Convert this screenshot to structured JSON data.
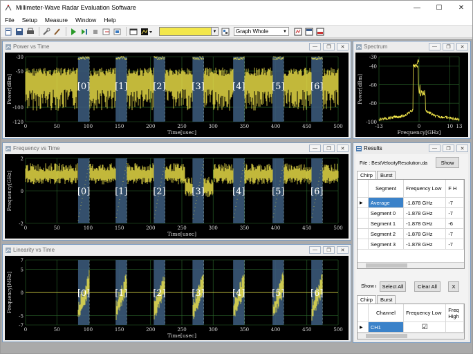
{
  "app": {
    "title": "Millimeter-Wave Radar Evaluation Software"
  },
  "menu": [
    "File",
    "Setup",
    "Measure",
    "Window",
    "Help"
  ],
  "toolbar": {
    "graph_mode": "Graph Whole",
    "trace_color": "#f3e74a"
  },
  "panels": {
    "power": {
      "title": "Power vs Time",
      "chart_data": {
        "type": "line",
        "xlabel": "Time[usec]",
        "ylabel": "Power[dBm]",
        "xlim": [
          0,
          500
        ],
        "ylim": [
          -120,
          -30
        ],
        "x_ticks": [
          "0",
          "50",
          "100",
          "150",
          "200",
          "250",
          "300",
          "350",
          "400",
          "450",
          "500"
        ],
        "y_ticks": [
          "-30",
          "-50",
          "-100",
          "-120"
        ],
        "chirp_labels": [
          "[0]",
          "[1]",
          "[2]",
          "[3]",
          "[4]",
          "[5]",
          "[6]"
        ],
        "chirp_centers": [
          92,
          152,
          213,
          275,
          340,
          403,
          465
        ]
      }
    },
    "spectrum": {
      "title": "Spectrum",
      "chart_data": {
        "type": "line",
        "xlabel": "Frequency[GHz]",
        "ylabel": "Power[dBm]",
        "xlim": [
          -13,
          13
        ],
        "ylim": [
          -100,
          -30
        ],
        "x_ticks": [
          "-13",
          "0",
          "10",
          "13"
        ],
        "y_ticks": [
          "-30",
          "-40",
          "-60",
          "-80",
          "-100"
        ]
      }
    },
    "frequency": {
      "title": "Frequency vs Time",
      "chart_data": {
        "type": "line",
        "xlabel": "Time[usec]",
        "ylabel": "Frequency[GHz]",
        "xlim": [
          0,
          500
        ],
        "ylim": [
          -2,
          2
        ],
        "x_ticks": [
          "0",
          "50",
          "100",
          "150",
          "200",
          "250",
          "300",
          "350",
          "400",
          "450",
          "500"
        ],
        "y_ticks": [
          "2",
          "0",
          "-2"
        ],
        "chirp_labels": [
          "[0]",
          "[1]",
          "[2]",
          "[3]",
          "[4]",
          "[5]",
          "[6]"
        ]
      }
    },
    "linearity": {
      "title": "Linearity vs Time",
      "chart_data": {
        "type": "line",
        "xlabel": "Time[usec]",
        "ylabel": "Frequency[MHz]",
        "xlim": [
          0,
          500
        ],
        "ylim": [
          -7,
          7
        ],
        "x_ticks": [
          "0",
          "50",
          "100",
          "150",
          "200",
          "250",
          "300",
          "350",
          "400",
          "450",
          "500"
        ],
        "y_ticks": [
          "7",
          "5",
          "0",
          "-5",
          "-7"
        ],
        "chirp_labels": [
          "[0]",
          "[1]",
          "[2]",
          "[3]",
          "[4]",
          "[5]",
          "[6]"
        ]
      }
    }
  },
  "results": {
    "title": "Results",
    "file_label": "File : BestVelocityResolution.da",
    "show_button": "Show",
    "tabs": [
      "Chirp",
      "Burst"
    ],
    "table1": {
      "headers": [
        "Segment",
        "Frequency Low",
        "F H"
      ],
      "rows": [
        [
          "Average",
          "-1.878 GHz",
          "-7"
        ],
        [
          "Segment 0",
          "-1.878 GHz",
          "-7"
        ],
        [
          "Segment 1",
          "-1.878 GHz",
          "-6"
        ],
        [
          "Segment 2",
          "-1.878 GHz",
          "-7"
        ],
        [
          "Segment 3",
          "-1.878 GHz",
          "-7"
        ]
      ]
    },
    "show_label": "Show n",
    "select_all": "Select All",
    "clear_all": "Clear All",
    "x_button": "X",
    "tabs2": [
      "Chirp",
      "Burst"
    ],
    "table2": {
      "headers": [
        "Channel",
        "Frequency Low",
        "Freq High"
      ],
      "rows": [
        [
          "CH1",
          "☑",
          ""
        ]
      ]
    }
  }
}
